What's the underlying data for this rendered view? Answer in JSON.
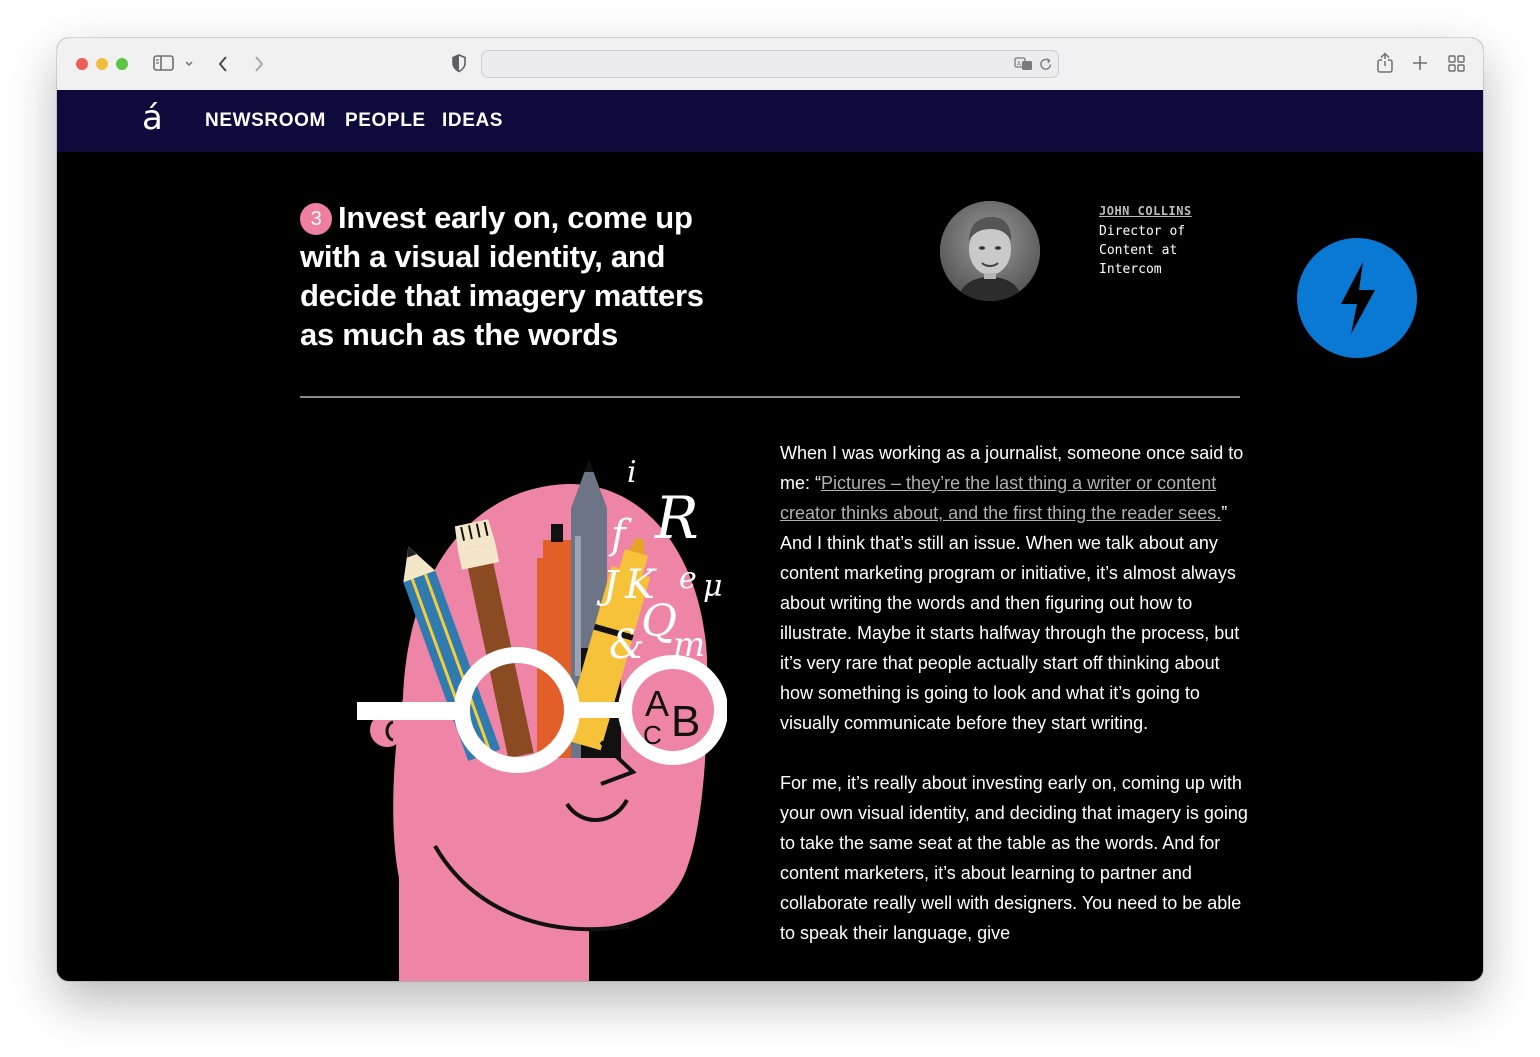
{
  "nav": {
    "logo": "á",
    "links": [
      "NEWSROOM",
      "PEOPLE",
      "IDEAS"
    ]
  },
  "article": {
    "badge": "3",
    "headline": "Invest early on, come up with a visual identity, and decide that imagery matters as much as the words",
    "author": {
      "name": "JOHN COLLINS",
      "role": "Director of Content at Intercom"
    },
    "p1_lead": "When I was working as a journalist, someone once said to me: “",
    "p1_link": "Pictures – they’re the last thing a writer or content creator thinks about, and the first thing the reader sees.",
    "p1_rest": "” And I think that’s still an issue. When we talk about any content marketing program or initiative, it’s almost always about writing the words and then figuring out how to illustrate. Maybe it starts halfway through the process, but it’s very rare that people actually start off thinking about how something is going to look and what it’s going to visually communicate before they start writing.",
    "p2": "For me, it’s really about investing early on, coming up with your own visual identity, and deciding that imagery is going to take the same seat at the table as the words. And for content marketers, it’s about learning to partner and collaborate really well with designers. You need to be able to speak their language, give"
  },
  "illustration": {
    "letters": [
      "i",
      "R",
      "f",
      "J",
      "K",
      "e",
      "μ",
      "Q",
      "&",
      "m",
      "A",
      "B",
      "C"
    ]
  },
  "icons": {
    "amp": "lightning-icon",
    "chat": "chat-icon"
  },
  "colors": {
    "nav_bg": "#0e0a3c",
    "amp_blue": "#0a79d4",
    "chat_purple": "#3922ec",
    "head_pink": "#ee85a7"
  }
}
